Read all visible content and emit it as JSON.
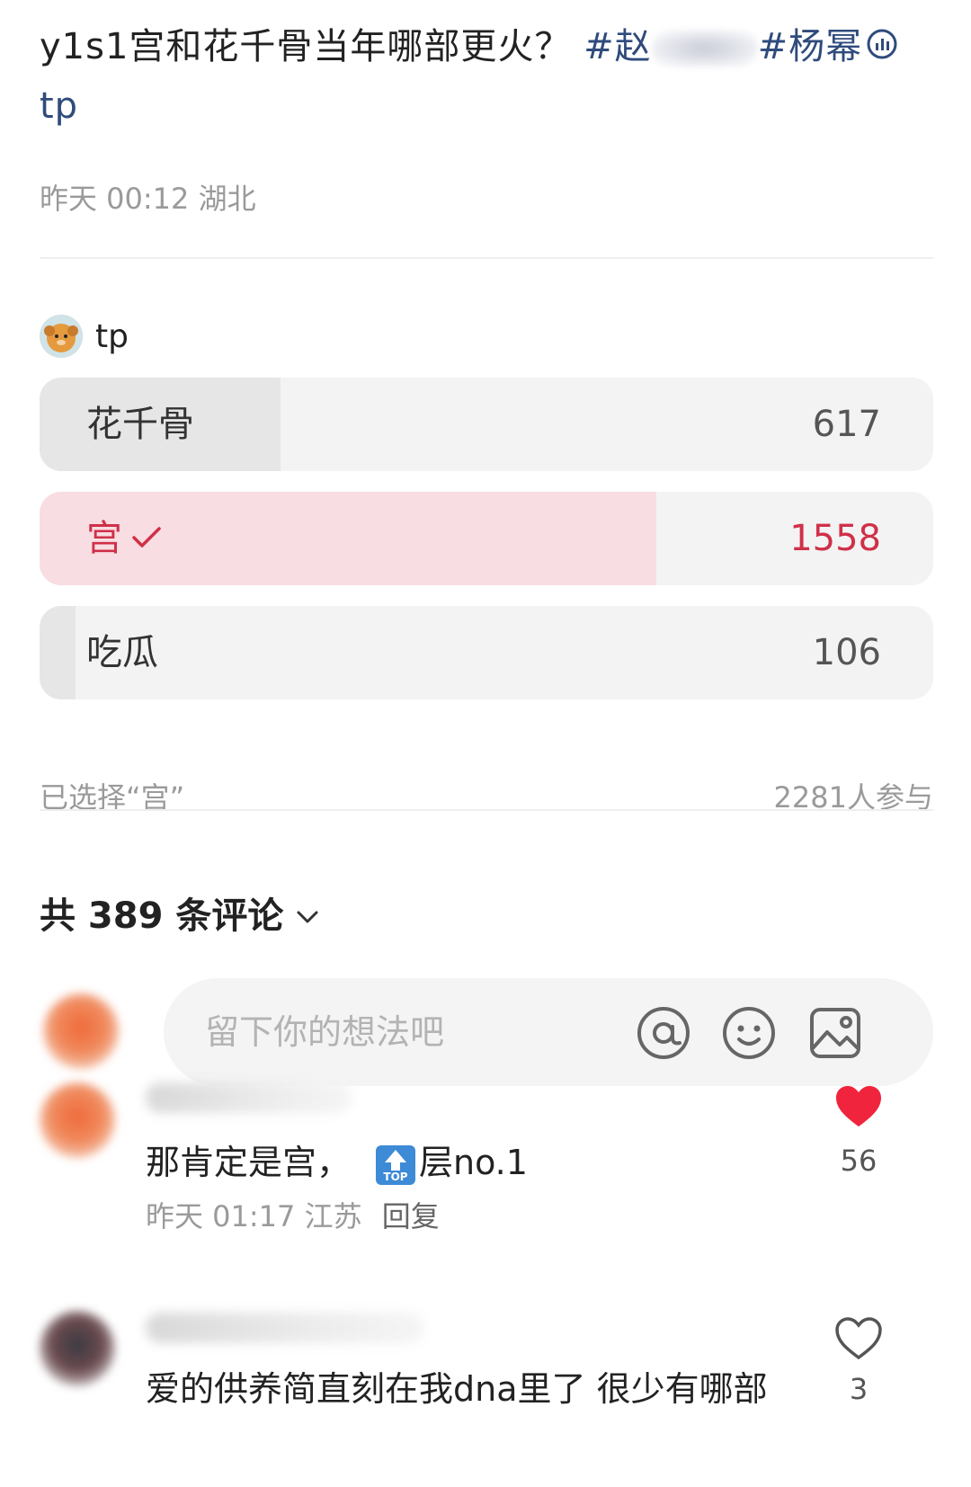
{
  "post": {
    "title": "y1s1宫和花千骨当年哪部更火？",
    "topic1_visible": "#赵",
    "topic2": "#杨幂",
    "author": "tp",
    "time": "昨天 00:12",
    "location": "湖北"
  },
  "poll": {
    "author": "tp",
    "options": [
      {
        "label": "花千骨",
        "count": "617",
        "fraction": 0.27,
        "selected": false
      },
      {
        "label": "宫",
        "count": "1558",
        "fraction": 0.69,
        "selected": true
      },
      {
        "label": "吃瓜",
        "count": "106",
        "fraction": 0.04,
        "selected": false
      }
    ],
    "selected_text": "已选择“宫”",
    "participants": "2281人参与"
  },
  "comments_header": {
    "label": "共 389 条评论"
  },
  "input": {
    "placeholder": "留下你的想法吧"
  },
  "comments": [
    {
      "text_before": "那肯定是宫，",
      "badge": "TOP",
      "text_after": "层no.1",
      "time": "昨天 01:17",
      "location": "江苏",
      "reply": "回复",
      "likes": "56",
      "liked": true
    },
    {
      "text": "爱的供养简直刻在我dna里了 很少有哪部",
      "likes": "3",
      "liked": false
    }
  ],
  "colors": {
    "accent": "#d03048",
    "selected_fill": "#f8dde2",
    "tag": "#2f4b7c",
    "like_red": "#f0243c"
  }
}
